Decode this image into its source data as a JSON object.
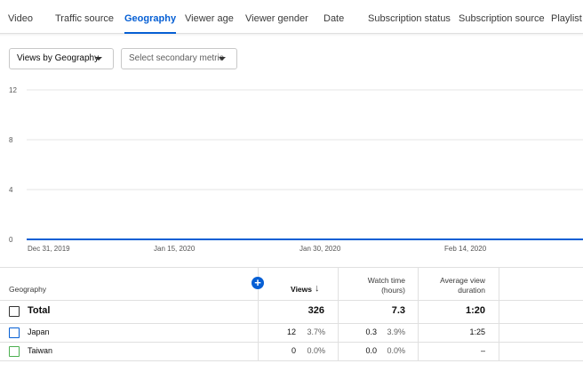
{
  "tabs": [
    {
      "label": "Video",
      "active": false
    },
    {
      "label": "Traffic source",
      "active": false
    },
    {
      "label": "Geography",
      "active": true
    },
    {
      "label": "Viewer age",
      "active": false
    },
    {
      "label": "Viewer gender",
      "active": false
    },
    {
      "label": "Date",
      "active": false
    },
    {
      "label": "Subscription status",
      "active": false
    },
    {
      "label": "Subscription source",
      "active": false
    },
    {
      "label": "Playlist",
      "active": false
    }
  ],
  "controls": {
    "primary_metric": "Views by Geography",
    "secondary_metric": "Select secondary metric"
  },
  "chart_data": {
    "type": "line",
    "x_tick_labels": [
      "Dec 31, 2019",
      "Jan 15, 2020",
      "Jan 30, 2020",
      "Feb 14, 2020"
    ],
    "y_ticks": [
      0,
      4,
      8,
      12
    ],
    "ylim": [
      0,
      12
    ],
    "grid": true,
    "series": [
      {
        "color": "#065fd4",
        "values": [
          0,
          0,
          0,
          0,
          0,
          0,
          0,
          0,
          0,
          0,
          0,
          0,
          0,
          0,
          0,
          0,
          0,
          0,
          0,
          0,
          0,
          0,
          0,
          0,
          0,
          0,
          0,
          0,
          0,
          0,
          0,
          0,
          0,
          0,
          0,
          0,
          0,
          0,
          0,
          0,
          0,
          0,
          0,
          0,
          0,
          0,
          0,
          0,
          0,
          0
        ]
      }
    ]
  },
  "table": {
    "headers": {
      "dimension": "Geography",
      "views": "Views",
      "watch_time_line1": "Watch time",
      "watch_time_line2": "(hours)",
      "avg_view_line1": "Average view",
      "avg_view_line2": "duration"
    },
    "total": {
      "label": "Total",
      "views": "326",
      "watch_time": "7.3",
      "avg_duration": "1:20"
    },
    "rows": [
      {
        "label": "Japan",
        "views": "12",
        "views_pct": "3.7%",
        "watch_time": "0.3",
        "watch_pct": "3.9%",
        "avg_duration": "1:25",
        "color": "#065fd4"
      },
      {
        "label": "Taiwan",
        "views": "0",
        "views_pct": "0.0%",
        "watch_time": "0.0",
        "watch_pct": "0.0%",
        "avg_duration": "–",
        "color": "#4caf50"
      }
    ]
  },
  "icons": {
    "add": "plus-circle-icon",
    "sort": "arrow-down-icon"
  }
}
